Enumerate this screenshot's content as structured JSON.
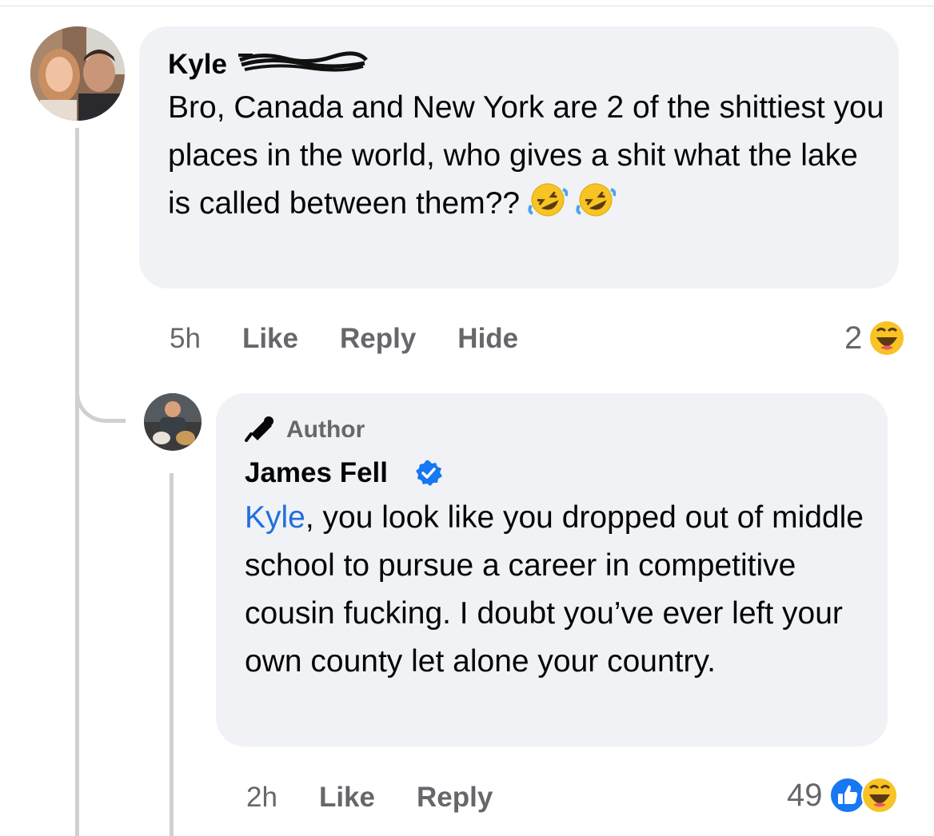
{
  "comments": [
    {
      "author": "Kyle",
      "text": "Bro, Canada and New York are 2 of the shittiest you places in the world, who gives a shit what the lake is called between them??",
      "emoji": [
        "rolling-on-floor-laughing",
        "rolling-on-floor-laughing"
      ],
      "time": "5h",
      "actions": {
        "like": "Like",
        "reply": "Reply",
        "hide": "Hide"
      },
      "reactions": {
        "count": "2",
        "types": [
          "haha"
        ]
      }
    },
    {
      "badge": "Author",
      "author": "James Fell",
      "verified": true,
      "mention": "Kyle",
      "text": ", you look like you dropped out of middle school to pursue a career in competitive cousin fucking. I doubt you’ve ever left your own county let alone your country.",
      "time": "2h",
      "actions": {
        "like": "Like",
        "reply": "Reply"
      },
      "reactions": {
        "count": "49",
        "types": [
          "like",
          "haha"
        ]
      }
    }
  ],
  "colors": {
    "bubble": "#f0f2f5",
    "meta_text": "#65676b",
    "mention": "#216fdb",
    "like_blue": "#1877f2",
    "verified": "#1877f2"
  }
}
